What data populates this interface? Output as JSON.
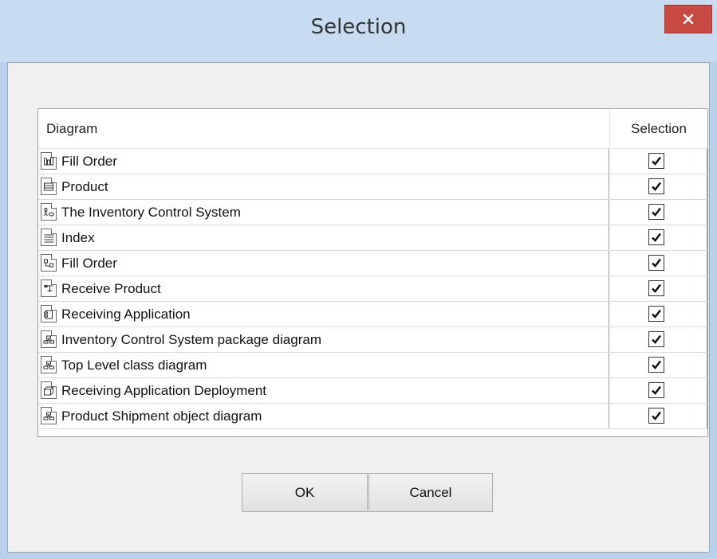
{
  "window": {
    "title": "Selection"
  },
  "table": {
    "headers": {
      "diagram": "Diagram",
      "selection": "Selection"
    },
    "rows": [
      {
        "label": "Fill Order",
        "icon": "activity-diagram-icon",
        "checked": true
      },
      {
        "label": "Product",
        "icon": "class-diagram-icon",
        "checked": true
      },
      {
        "label": "The Inventory Control System",
        "icon": "use-case-diagram-icon",
        "checked": true
      },
      {
        "label": "Index",
        "icon": "list-document-icon",
        "checked": true
      },
      {
        "label": "Fill Order",
        "icon": "sequence-diagram-icon",
        "checked": true
      },
      {
        "label": "Receive Product",
        "icon": "state-diagram-icon",
        "checked": true
      },
      {
        "label": "Receiving Application",
        "icon": "component-diagram-icon",
        "checked": true
      },
      {
        "label": "Inventory Control System package diagram",
        "icon": "package-diagram-icon",
        "checked": true
      },
      {
        "label": "Top Level class diagram",
        "icon": "package-diagram-icon",
        "checked": true
      },
      {
        "label": "Receiving Application Deployment",
        "icon": "deployment-diagram-icon",
        "checked": true
      },
      {
        "label": "Product Shipment object diagram",
        "icon": "package-diagram-icon",
        "checked": true
      }
    ]
  },
  "buttons": {
    "ok": "OK",
    "cancel": "Cancel"
  },
  "colors": {
    "title_bar": "#c7dcf0",
    "close_button": "#c74a43",
    "dialog_body": "#f0f0f0"
  }
}
